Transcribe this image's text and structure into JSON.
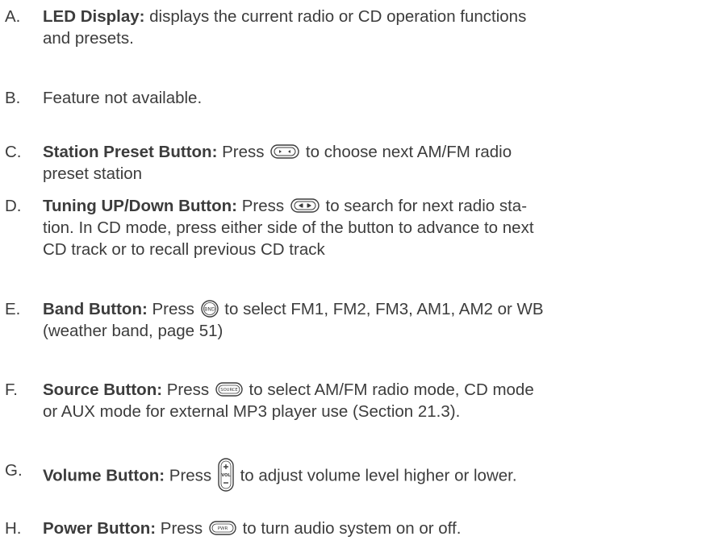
{
  "items": [
    {
      "letter": "A.",
      "label": "LED Display:",
      "text_before": " displays the current radio or CD operation functions",
      "text_line2": "and presets.",
      "icon": null
    },
    {
      "letter": "B.",
      "text": "Feature not available."
    },
    {
      "letter": "C.",
      "label": "Station Preset Button:",
      "text_before": " Press ",
      "icon": "preset-button-icon",
      "text_after": " to choose next AM/FM radio",
      "text_line2": "preset station"
    },
    {
      "letter": "D.",
      "label": "Tuning UP/Down Button:",
      "text_before": " Press ",
      "icon": "tuning-button-icon",
      "text_after": " to search for next radio sta-",
      "text_line2": "tion. In CD mode, press either side of the button to advance to next",
      "text_line3": "CD track or to recall previous CD track"
    },
    {
      "letter": "E.",
      "label": "Band Button:",
      "text_before": " Press ",
      "icon": "band-button-icon",
      "icon_text": "BND",
      "text_after": " to select FM1, FM2, FM3, AM1, AM2 or WB",
      "text_line2": "(weather band, page 51)"
    },
    {
      "letter": "F.",
      "label": "Source Button:",
      "text_before": " Press ",
      "icon": "source-button-icon",
      "icon_text": "SOURCE",
      "text_after": " to select AM/FM radio mode, CD mode",
      "text_line2": "or AUX mode for external MP3 player use (Section 21.3)."
    },
    {
      "letter": "G.",
      "label": "Volume Button:",
      "text_before": " Press ",
      "icon": "volume-button-icon",
      "icon_text": "VOL",
      "text_after": " to adjust volume level higher or lower."
    },
    {
      "letter": "H.",
      "label": "Power Button:",
      "text_before": " Press ",
      "icon": "power-button-icon",
      "icon_text": "PWR",
      "text_after": " to turn audio system on or off."
    }
  ]
}
